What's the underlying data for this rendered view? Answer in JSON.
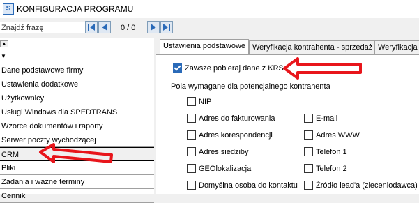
{
  "window": {
    "title": "KONFIGURACJA PROGRAMU",
    "app_icon_letter": "S"
  },
  "search": {
    "placeholder": "Znajdź frazę",
    "counter": "0 / 0"
  },
  "sidebar": {
    "items": [
      {
        "label": "Dane podstawowe firmy"
      },
      {
        "label": "Ustawienia dodatkowe"
      },
      {
        "label": "Użytkownicy"
      },
      {
        "label": "Usługi Windows dla SPEDTRANS"
      },
      {
        "label": "Wzorce dokumentów i raporty"
      },
      {
        "label": "Serwer poczty wychodzącej"
      },
      {
        "label": "CRM",
        "selected": true
      },
      {
        "label": "Pliki"
      },
      {
        "label": "Zadania i ważne terminy"
      },
      {
        "label": "Cenniki"
      }
    ]
  },
  "tabs": [
    {
      "label": "Ustawienia podstawowe",
      "active": true
    },
    {
      "label": "Weryfikacja kontrahenta - sprzedaż"
    },
    {
      "label": "Weryfikacja"
    }
  ],
  "settings": {
    "always_fetch_krs": {
      "label": "Zawsze pobieraj dane z KRS",
      "checked": true
    },
    "required_fields_label": "Pola wymagane dla potencjalnego kontrahenta",
    "left_column": [
      {
        "label": "NIP",
        "checked": false
      },
      {
        "label": "Adres do fakturowania",
        "checked": false
      },
      {
        "label": "Adres korespondencji",
        "checked": false
      },
      {
        "label": "Adres siedziby",
        "checked": false
      },
      {
        "label": "GEOlokalizacja",
        "checked": false
      },
      {
        "label": "Domyślna osoba do kontaktu",
        "checked": false
      }
    ],
    "right_column": [
      {
        "label": "E-mail",
        "checked": false
      },
      {
        "label": "Adres WWW",
        "checked": false
      },
      {
        "label": "Telefon 1",
        "checked": false
      },
      {
        "label": "Telefon 2",
        "checked": false
      },
      {
        "label": "Źródło lead'a (zleceniodawca)",
        "checked": false
      }
    ]
  },
  "colors": {
    "accent": "#2a6ab8",
    "annotation_arrow": "#e8151b"
  }
}
